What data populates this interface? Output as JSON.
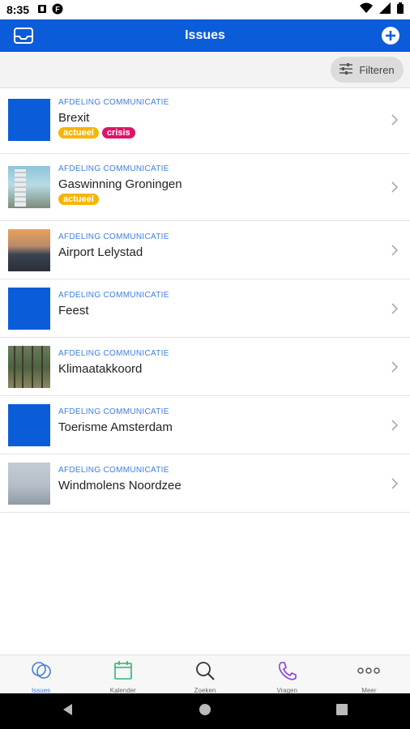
{
  "status": {
    "time": "8:35"
  },
  "header": {
    "title": "Issues"
  },
  "filter": {
    "label": "Filteren"
  },
  "issues": [
    {
      "category": "AFDELING COMMUNICATIE",
      "title": "Brexit",
      "tags": [
        "actueel",
        "crisis"
      ]
    },
    {
      "category": "AFDELING COMMUNICATIE",
      "title": "Gaswinning Groningen",
      "tags": [
        "actueel"
      ]
    },
    {
      "category": "AFDELING COMMUNICATIE",
      "title": "Airport Lelystad",
      "tags": []
    },
    {
      "category": "AFDELING COMMUNICATIE",
      "title": "Feest",
      "tags": []
    },
    {
      "category": "AFDELING COMMUNICATIE",
      "title": "Klimaatakkoord",
      "tags": []
    },
    {
      "category": "AFDELING COMMUNICATIE",
      "title": "Toerisme Amsterdam",
      "tags": []
    },
    {
      "category": "AFDELING COMMUNICATIE",
      "title": "Windmolens Noordzee",
      "tags": []
    }
  ],
  "tabs": [
    {
      "label": "Issues",
      "icon": "chat-bubbles-icon"
    },
    {
      "label": "Kalender",
      "icon": "calendar-icon"
    },
    {
      "label": "Zoeken",
      "icon": "search-icon"
    },
    {
      "label": "Vragen",
      "icon": "phone-icon"
    },
    {
      "label": "Meer",
      "icon": "more-icon"
    }
  ],
  "colors": {
    "primary": "#0b5cd8",
    "category": "#3f7de0",
    "tag_actueel": "#f7b500",
    "tag_crisis": "#e01467",
    "calendar": "#2bb673",
    "phone": "#8e3dd6"
  }
}
